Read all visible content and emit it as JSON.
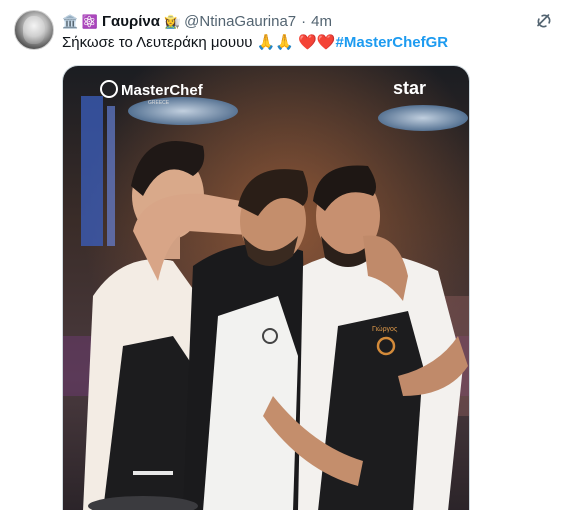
{
  "tweet": {
    "name_prefix_emoji": "🏛️ ⚛️",
    "display_name": "Γαυρίνα",
    "name_suffix_emoji": "👩‍🌾",
    "handle": "@NtinaGaurina7",
    "separator": "·",
    "timestamp": "4m",
    "text_before": "Σήκωσε το Λευτεράκη μουυυ",
    "prayer_emoji": "🙏🙏",
    "hearts": "❤️❤️",
    "hashtag": "#MasterChefGR"
  },
  "media": {
    "show_logo": "MasterChef",
    "show_logo_sub": "GREECE",
    "channel_logo": "star",
    "apron_name_tag": "Γιώργος"
  },
  "icons": {
    "header_action": "grok-icon"
  },
  "colors": {
    "hashtag": "#1d9bf0",
    "secondary_text": "#536471",
    "heart": "#e0245e"
  }
}
